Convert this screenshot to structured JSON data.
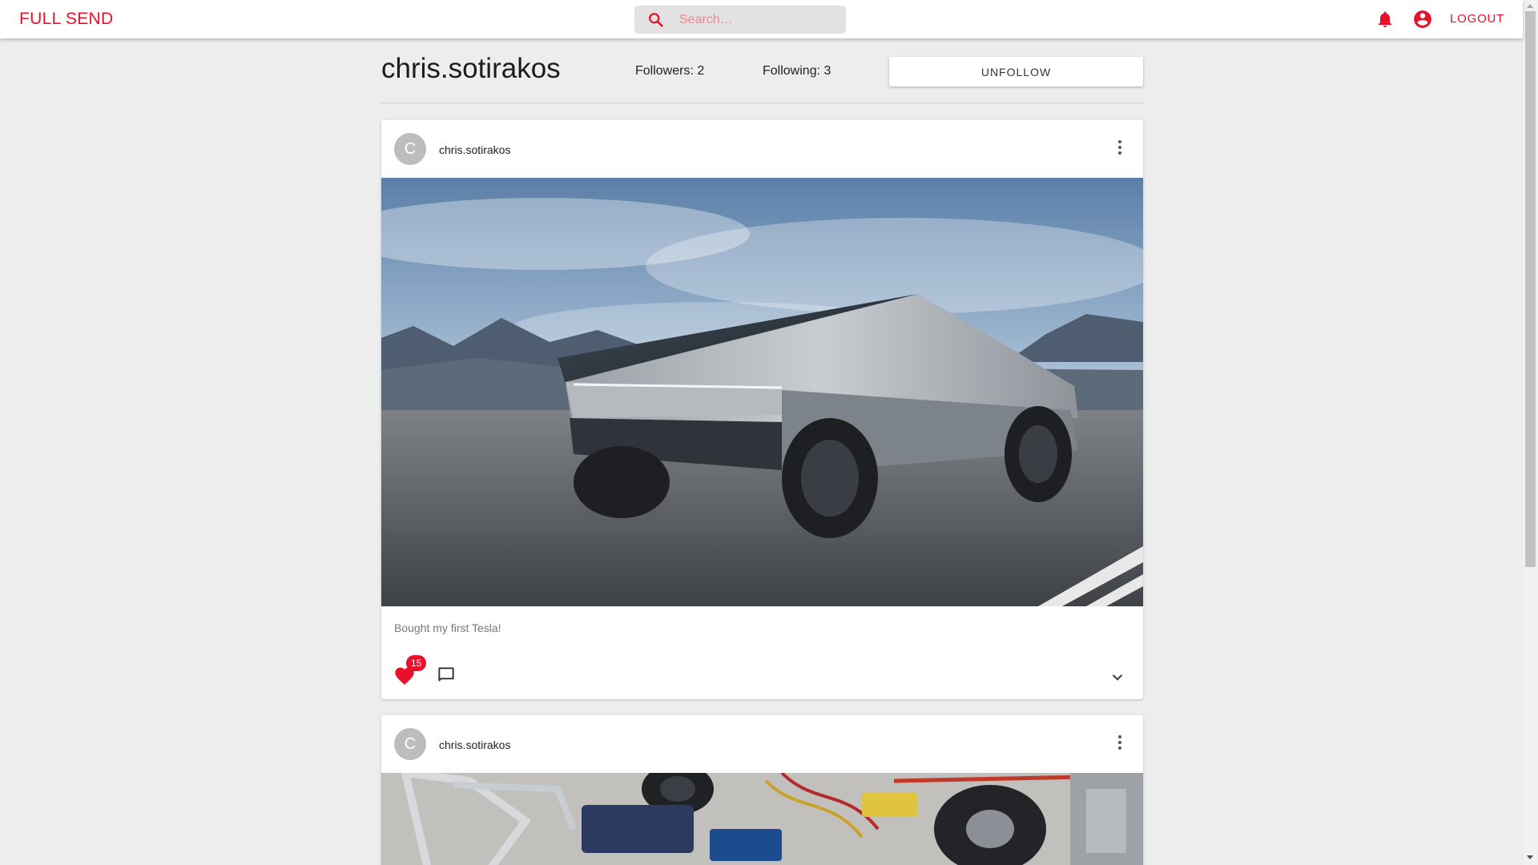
{
  "appbar": {
    "brand": "FULL SEND",
    "search_placeholder": "Search…",
    "logout_label": "LOGOUT",
    "icons": {
      "search": "search-icon",
      "notifications": "bell-icon",
      "account": "account-circle-icon"
    },
    "accent_color": "#e8102a"
  },
  "profile": {
    "username": "chris.sotirakos",
    "followers": "Followers: 2",
    "following": "Following: 3",
    "unfollow_label": "UNFOLLOW"
  },
  "posts": [
    {
      "avatar_letter": "C",
      "username": "chris.sotirakos",
      "caption": "Bought my first Tesla!",
      "likes": "15",
      "photo": "cybertruck-photo"
    },
    {
      "avatar_letter": "C",
      "username": "chris.sotirakos",
      "photo": "rc-car-parts-photo"
    }
  ]
}
